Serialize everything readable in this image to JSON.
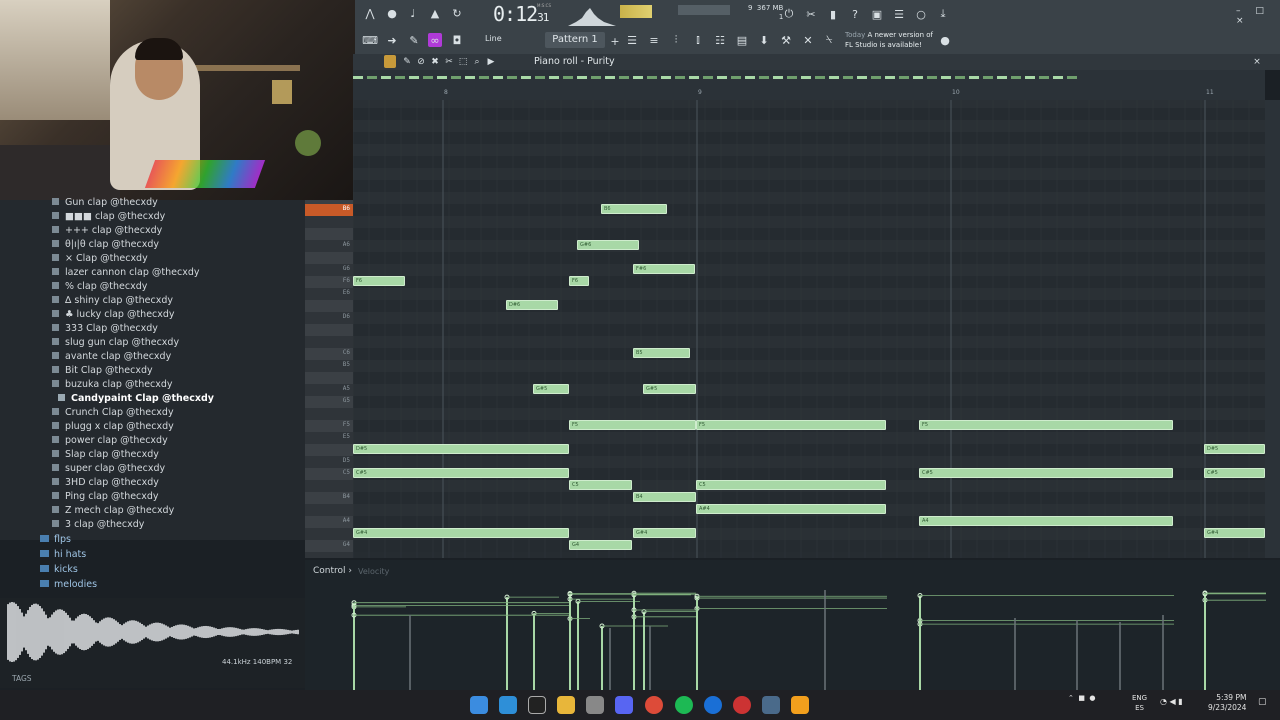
{
  "webcam": {
    "label": "streamer webcam"
  },
  "browser": {
    "items": [
      "Gun clap @thecxdy",
      "■■■ clap @thecxdy",
      "+++ clap @thecxdy",
      "θ|ı|θ clap @thecxdy",
      "× Clap @thecxdy",
      "lazer cannon clap @thecxdy",
      "% clap @thecxdy",
      "∆ shiny clap @thecxdy",
      "♣ lucky clap @thecxdy",
      "333 Clap @thecxdy",
      "slug gun clap @thecxdy",
      "avante clap @thecxdy",
      "Bit Clap @thecxdy",
      "buzuka clap @thecxdy",
      "Candypaint Clap @thecxdy",
      "Crunch Clap @thecxdy",
      "plugg x clap @thecxdy",
      "power clap @thecxdy",
      "Slap clap @thecxdy",
      "super clap @thecxdy",
      "3HD clap @thecxdy",
      "Ping clap @thecxdy",
      "Z mech clap @thecxdy",
      "3 clap @thecxdy"
    ],
    "selected_index": 14,
    "folders": [
      "flps",
      "hi hats",
      "kicks",
      "melodies"
    ],
    "sample_info": "44.1kHz 140BPM 32",
    "tags_label": "TAGS"
  },
  "toolbar": {
    "time": "0:12",
    "time_small": "31",
    "time_unit": "M:S:CS",
    "pattern": "Pattern 1",
    "line_mode": "Line",
    "cpu_voices": "9",
    "memory": "367 MB",
    "cpu_num": "1",
    "hint_today": "Today",
    "hint_text": "A newer version of FL Studio is available!",
    "win_controls": "– □ ×"
  },
  "piano_roll": {
    "title": "Piano roll - Purity",
    "bar_numbers": [
      "8",
      "9",
      "10",
      "11"
    ],
    "key_labels": [
      "B6",
      "A6",
      "G6",
      "F6",
      "E6",
      "D6",
      "C6",
      "B5",
      "A5",
      "G5",
      "F5",
      "E5",
      "D5",
      "C5",
      "B4",
      "A4",
      "G4"
    ],
    "notes": [
      {
        "label": "B6",
        "col": 248,
        "row": 0,
        "len": 66
      },
      {
        "label": "G#6",
        "col": 224,
        "row": 3,
        "len": 62
      },
      {
        "label": "F#6",
        "col": 280,
        "row": 5,
        "len": 62
      },
      {
        "label": "F6",
        "col": 0,
        "row": 6,
        "len": 52
      },
      {
        "label": "F6",
        "col": 216,
        "row": 6,
        "len": 20
      },
      {
        "label": "D#6",
        "col": 153,
        "row": 8,
        "len": 52
      },
      {
        "label": "B5",
        "col": 280,
        "row": 12,
        "len": 57
      },
      {
        "label": "G#5",
        "col": 180,
        "row": 15,
        "len": 36
      },
      {
        "label": "G#5",
        "col": 290,
        "row": 15,
        "len": 53
      },
      {
        "label": "F5",
        "col": 216,
        "row": 18,
        "len": 127
      },
      {
        "label": "F5",
        "col": 343,
        "row": 18,
        "len": 190
      },
      {
        "label": "F5",
        "col": 566,
        "row": 18,
        "len": 254
      },
      {
        "label": "D#5",
        "col": 0,
        "row": 20,
        "len": 216
      },
      {
        "label": "D#5",
        "col": 851,
        "row": 20,
        "len": 61
      },
      {
        "label": "C#5",
        "col": 0,
        "row": 22,
        "len": 216
      },
      {
        "label": "C#5",
        "col": 566,
        "row": 22,
        "len": 254
      },
      {
        "label": "C#5",
        "col": 851,
        "row": 22,
        "len": 61
      },
      {
        "label": "C5",
        "col": 216,
        "row": 23,
        "len": 63
      },
      {
        "label": "C5",
        "col": 343,
        "row": 23,
        "len": 190
      },
      {
        "label": "B4",
        "col": 280,
        "row": 24,
        "len": 63
      },
      {
        "label": "A#4",
        "col": 343,
        "row": 25,
        "len": 190
      },
      {
        "label": "A4",
        "col": 566,
        "row": 26,
        "len": 254
      },
      {
        "label": "G#4",
        "col": 0,
        "row": 27,
        "len": 216
      },
      {
        "label": "G#4",
        "col": 280,
        "row": 27,
        "len": 63
      },
      {
        "label": "G#4",
        "col": 851,
        "row": 27,
        "len": 61
      },
      {
        "label": "G4",
        "col": 216,
        "row": 28,
        "len": 63
      }
    ]
  },
  "control": {
    "label": "Control ›",
    "mode": "Velocity"
  },
  "taskbar": {
    "lang_top": "ENG",
    "lang_bottom": "ES",
    "time": "5:39 PM",
    "date": "9/23/2024"
  }
}
